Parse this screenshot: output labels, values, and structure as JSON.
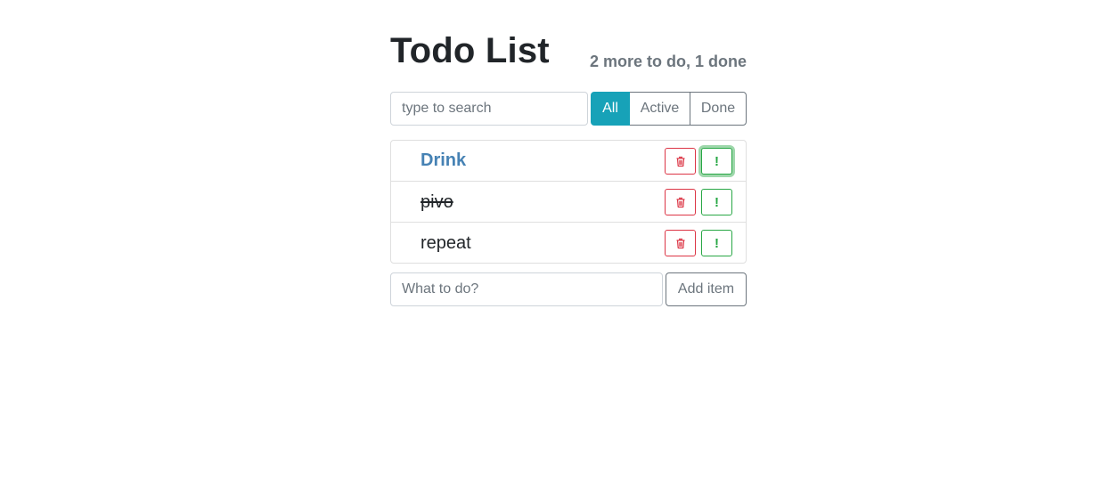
{
  "header": {
    "title": "Todo List",
    "status": "2 more to do, 1 done"
  },
  "search": {
    "placeholder": "type to search",
    "value": ""
  },
  "filters": [
    {
      "label": "All",
      "active": true
    },
    {
      "label": "Active",
      "active": false
    },
    {
      "label": "Done",
      "active": false
    }
  ],
  "todos": [
    {
      "label": "Drink",
      "important": true,
      "done": false,
      "delete_icon": "trash-icon",
      "important_label": "!"
    },
    {
      "label": "pivo",
      "important": false,
      "done": true,
      "delete_icon": "trash-icon",
      "important_label": "!"
    },
    {
      "label": "repeat",
      "important": false,
      "done": false,
      "delete_icon": "trash-icon",
      "important_label": "!"
    }
  ],
  "add_form": {
    "placeholder": "What to do?",
    "value": "",
    "button_label": "Add item"
  },
  "colors": {
    "accent": "#17a2b8",
    "danger": "#dc3545",
    "success": "#28a745",
    "important_text": "#4682b4",
    "muted": "#6c757d"
  }
}
